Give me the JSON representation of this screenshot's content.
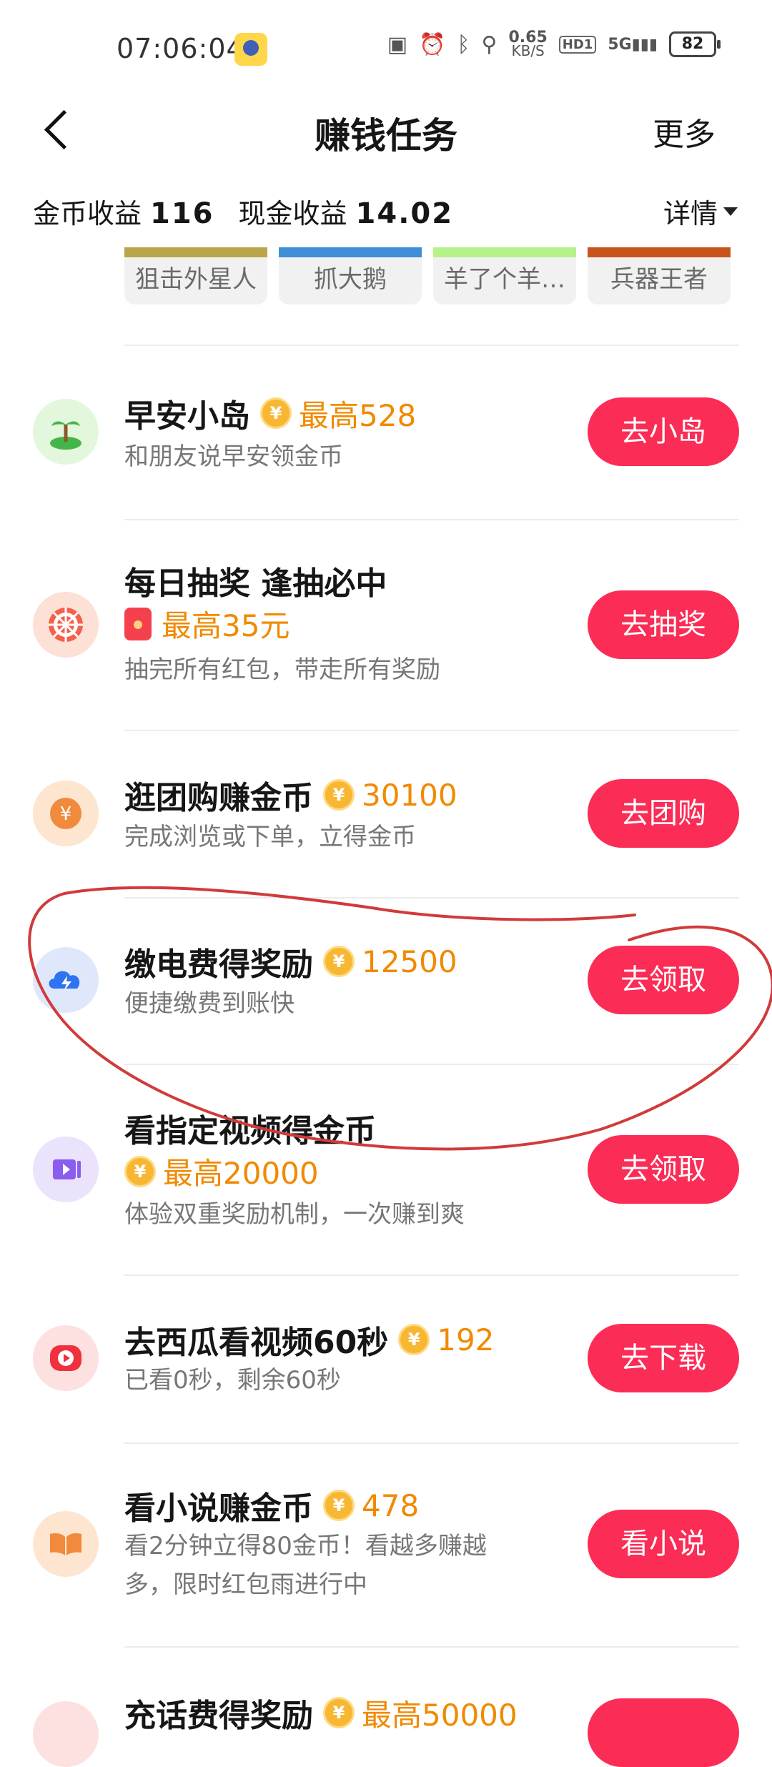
{
  "status_bar": {
    "time": "07:06:04",
    "speed_value": "0.65",
    "speed_unit": "KB/S",
    "hd": "HD1",
    "network": "5G",
    "battery": "82"
  },
  "header": {
    "title": "赚钱任务",
    "more": "更多"
  },
  "earnings": {
    "coin_label": "金币收益",
    "coin_value": "116",
    "cash_label": "现金收益",
    "cash_value": "14.02",
    "details": "详情"
  },
  "games": [
    {
      "label": "狙击外星人",
      "color": "#b9a64a"
    },
    {
      "label": "抓大鹅",
      "color": "#3f8fd8"
    },
    {
      "label": "羊了个羊…",
      "color": "#b6f28a"
    },
    {
      "label": "兵器王者",
      "color": "#c9541b"
    }
  ],
  "tasks": [
    {
      "title": "早安小岛",
      "reward": "最高528",
      "desc": "和朋友说早安领金币",
      "button": "去小岛",
      "icon": "island-icon",
      "icon_bg": "#e3f7dd"
    },
    {
      "title": "每日抽奖 逢抽必中",
      "reward": "最高35元",
      "desc": "抽完所有红包，带走所有奖励",
      "button": "去抽奖",
      "icon": "lottery-wheel-icon",
      "icon_bg": "#fde0d6"
    },
    {
      "title": "逛团购赚金币",
      "reward": "30100",
      "desc": "完成浏览或下单，立得金币",
      "button": "去团购",
      "icon": "yuan-coin-icon",
      "icon_bg": "#fde5cf"
    },
    {
      "title": "缴电费得奖励",
      "reward": "12500",
      "desc": "便捷缴费到账快",
      "button": "去领取",
      "icon": "electric-cloud-icon",
      "icon_bg": "#dfe8fb"
    },
    {
      "title": "看指定视频得金币",
      "reward": "最高20000",
      "desc": "体验双重奖励机制，一次赚到爽",
      "button": "去领取",
      "icon": "video-icon",
      "icon_bg": "#ebe3fb"
    },
    {
      "title": "去西瓜看视频60秒",
      "reward": "192",
      "desc": "已看0秒，剩余60秒",
      "button": "去下载",
      "icon": "xigua-play-icon",
      "icon_bg": "#fde0e0"
    },
    {
      "title": "看小说赚金币",
      "reward": "478",
      "desc": "看2分钟立得80金币！看越多赚越多，限时红包雨进行中",
      "button": "看小说",
      "icon": "book-icon",
      "icon_bg": "#fde5cf"
    },
    {
      "title": "充话费得奖励",
      "reward": "最高50000"
    }
  ]
}
